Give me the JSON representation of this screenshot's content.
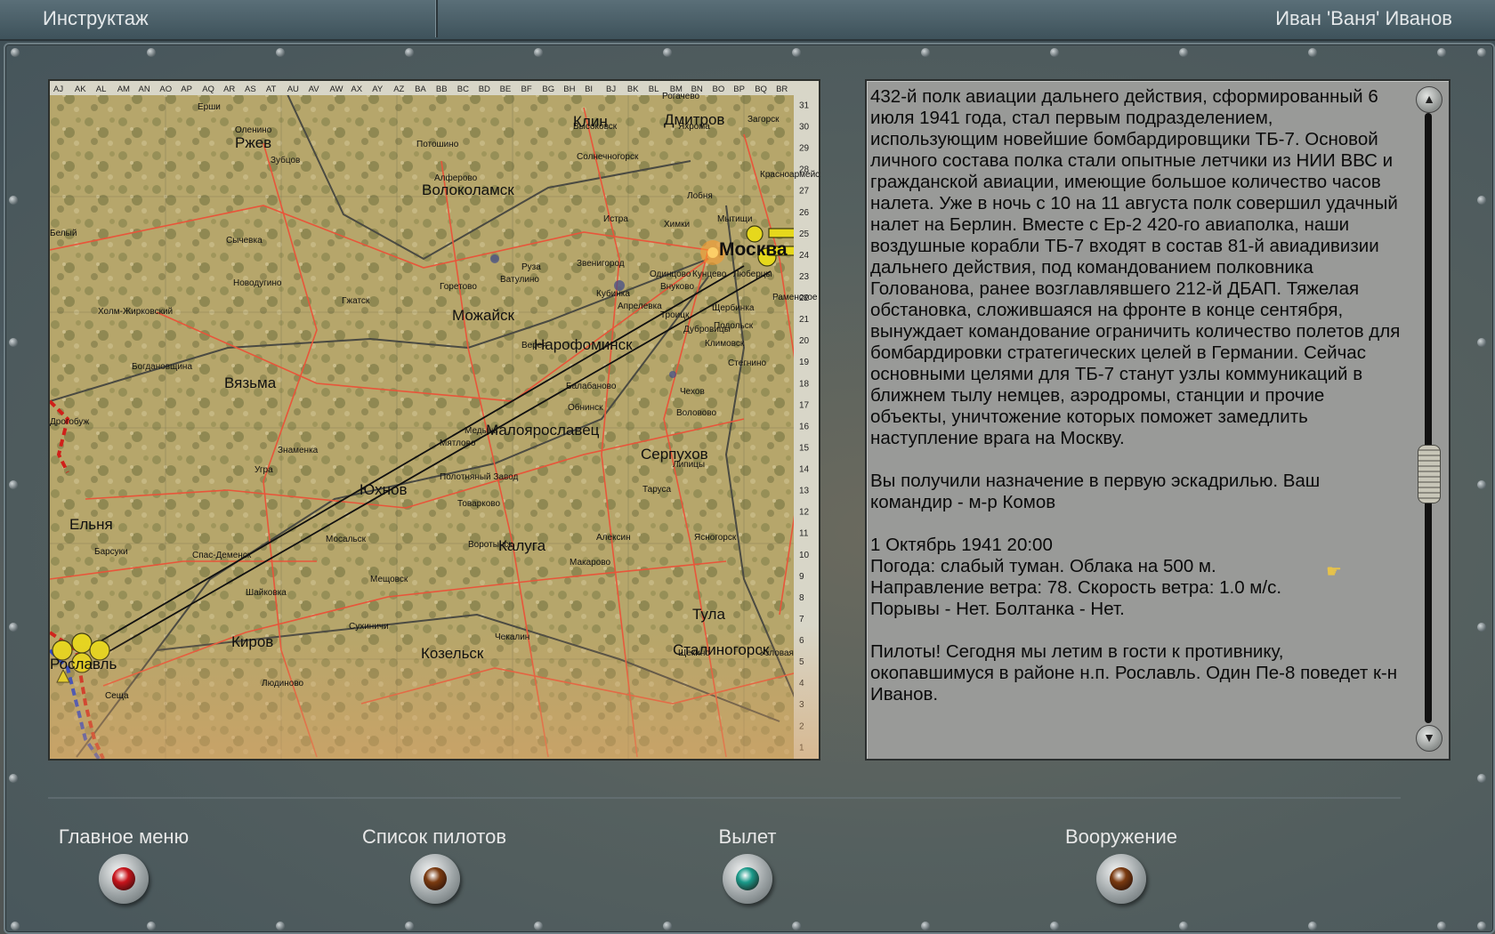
{
  "header": {
    "section_title": "Инструктаж",
    "pilot_name": "Иван 'Ваня' Иванов"
  },
  "map": {
    "col_labels": [
      "AJ",
      "AK",
      "AL",
      "AM",
      "AN",
      "AO",
      "AP",
      "AQ",
      "AR",
      "AS",
      "AT",
      "AU",
      "AV",
      "AW",
      "AX",
      "AY",
      "AZ",
      "BA",
      "BB",
      "BC",
      "BD",
      "BE",
      "BF",
      "BG",
      "BH",
      "BI",
      "BJ",
      "BK",
      "BL",
      "BM",
      "BN",
      "BO",
      "BP",
      "BQ",
      "BR"
    ],
    "row_labels": [
      "31",
      "30",
      "29",
      "28",
      "27",
      "26",
      "25",
      "24",
      "23",
      "22",
      "21",
      "20",
      "19",
      "18",
      "17",
      "16",
      "15",
      "14",
      "13",
      "12",
      "11",
      "10",
      "9",
      "8",
      "7",
      "6",
      "5",
      "4",
      "3",
      "2",
      "1"
    ],
    "cities_big": [
      "Клин",
      "Дмитров",
      "Ржев",
      "Волоколамск",
      "Москва",
      "Можайск",
      "Нарофоминск",
      "Вязьма",
      "Малоярославец",
      "Серпухов",
      "Юхнов",
      "Ельня",
      "Калуга",
      "Тула",
      "Киров",
      "Козельск",
      "Сталиногорск",
      "Рославль"
    ],
    "cities_small": [
      "Рогачево",
      "Ерши",
      "Высоковск",
      "Загорск",
      "Яхрома",
      "Оленино",
      "Зубцов",
      "Солнечногорск",
      "Потошино",
      "Красноармейск",
      "Алферово",
      "Лобня",
      "Истра",
      "Химки",
      "Мытищи",
      "Белый",
      "Сычевка",
      "Звенигород",
      "Одинцово",
      "Кунцево",
      "Люберцы",
      "Новодугино",
      "Руза",
      "Ватулино",
      "Горетово",
      "Кубинка",
      "Апрелевка",
      "Внуково",
      "Щербинка",
      "Раменское",
      "Холм-Жирковский",
      "Гжатск",
      "Троицк",
      "Подольск",
      "Дубровицы",
      "Верея",
      "Климовск",
      "Богдановщина",
      "Стегнино",
      "Балабаново",
      "Обнинск",
      "Чехов",
      "Медынь",
      "Воловово",
      "Дрогобуж",
      "Знаменка",
      "Мятлово",
      "Липицы",
      "Угра",
      "Полотняный Завод",
      "Таруса",
      "Товарково",
      "Барсуки",
      "Спас-Деменск",
      "Мосальск",
      "Воротынск",
      "Алексин",
      "Ясногорск",
      "Макарово",
      "Шайковка",
      "Мещовск",
      "Сухиничи",
      "Чекалин",
      "Щекино",
      "Узловая",
      "Людиново",
      "Сещa"
    ],
    "colors": {
      "terrain": "#b6a66b",
      "road": "#e8553a",
      "rail": "#4a4a42",
      "front_red": "#d0201a",
      "front_blue": "#1d3fd0",
      "route": "#101010",
      "marker": "#e6d81c"
    }
  },
  "briefing": {
    "paragraphs": [
      "432-й полк авиации дальнего действия, сформированный 6 июля 1941 года, стал первым подразделением, использующим новейшие бомбардировщики ТБ-7. Основой личного состава полка стали опытные летчики из НИИ ВВС и гражданской авиации, имеющие большое количество часов налета. Уже в ночь с 10 на 11 августа полк совершил удачный налет на Берлин. Вместе с Ер-2 420-го авиаполка, наши воздушные корабли ТБ-7 входят в состав 81-й авиадивизии дальнего действия, под командованием полковника Голованова, ранее возглавлявшего 212-й ДБАП. Тяжелая обстановка, сложившаяся на фронте в конце сентября, вынуждает командование ограничить количество полетов для бомбардировки стратегических целей в Германии. Сейчас основными целями для ТБ-7 станут узлы коммуникаций в ближнем тылу немцев, аэродромы, станции и прочие объекты, уничтожение которых поможет замедлить наступление врага на Москву.",
      "Вы получили назначение в первую эскадрилью. Ваш командир - м-р Комов"
    ],
    "date_line": "1 Октябрь 1941 20:00",
    "weather_line": "Погода: слабый туман. Облака на 500 м.",
    "wind_line": "Направление ветра: 78. Скорость ветра: 1.0 м/с.",
    "gusts_line": "Порывы - Нет. Болтанка - Нет.",
    "orders": "Пилоты! Сегодня мы летим в гости к противнику, окопавшимуся в районе н.п. Рославль. Один Пе-8 поведет к-н Иванов.",
    "scroll_position": 0.6
  },
  "buttons": [
    {
      "label": "Главное меню",
      "lamp": "#c8141c"
    },
    {
      "label": "Список пилотов",
      "lamp": "#7a3a10"
    },
    {
      "label": "Вылет",
      "lamp": "#1a9a8a"
    },
    {
      "label": "Вооружение",
      "lamp": "#7a3a10"
    }
  ]
}
